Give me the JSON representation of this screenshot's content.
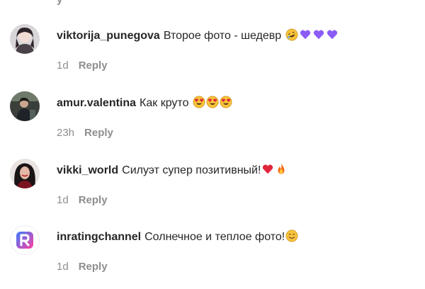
{
  "top_fragment": "y",
  "comments": [
    {
      "username": "viktorija_punegova",
      "text": "Второе фото - шедевр",
      "emojis": [
        "rolling-laughing-emoji",
        "purple-heart-emoji",
        "purple-heart-emoji",
        "purple-heart-emoji"
      ],
      "time": "1d",
      "reply_label": "Reply"
    },
    {
      "username": "amur.valentina",
      "text": "Как круто",
      "emojis": [
        "heart-eyes-emoji",
        "heart-eyes-emoji",
        "heart-eyes-emoji"
      ],
      "time": "23h",
      "reply_label": "Reply"
    },
    {
      "username": "vikki_world",
      "text": "Силуэт супер позитивный!",
      "emojis": [
        "red-heart-emoji",
        "fire-emoji"
      ],
      "time": "1d",
      "reply_label": "Reply"
    },
    {
      "username": "inratingchannel",
      "text": "Солнечное и теплое фото!",
      "emojis": [
        "smiling-face-emoji"
      ],
      "time": "1d",
      "reply_label": "Reply"
    }
  ],
  "colors": {
    "username": "#262626",
    "meta": "#8e8e8e",
    "purple_heart": "#8b5cf6",
    "red_heart": "#e0243a",
    "emoji_yellow": "#f7c33a",
    "brand_logo_blue": "#3a7bff",
    "brand_logo_pink": "#ff3fa0"
  }
}
